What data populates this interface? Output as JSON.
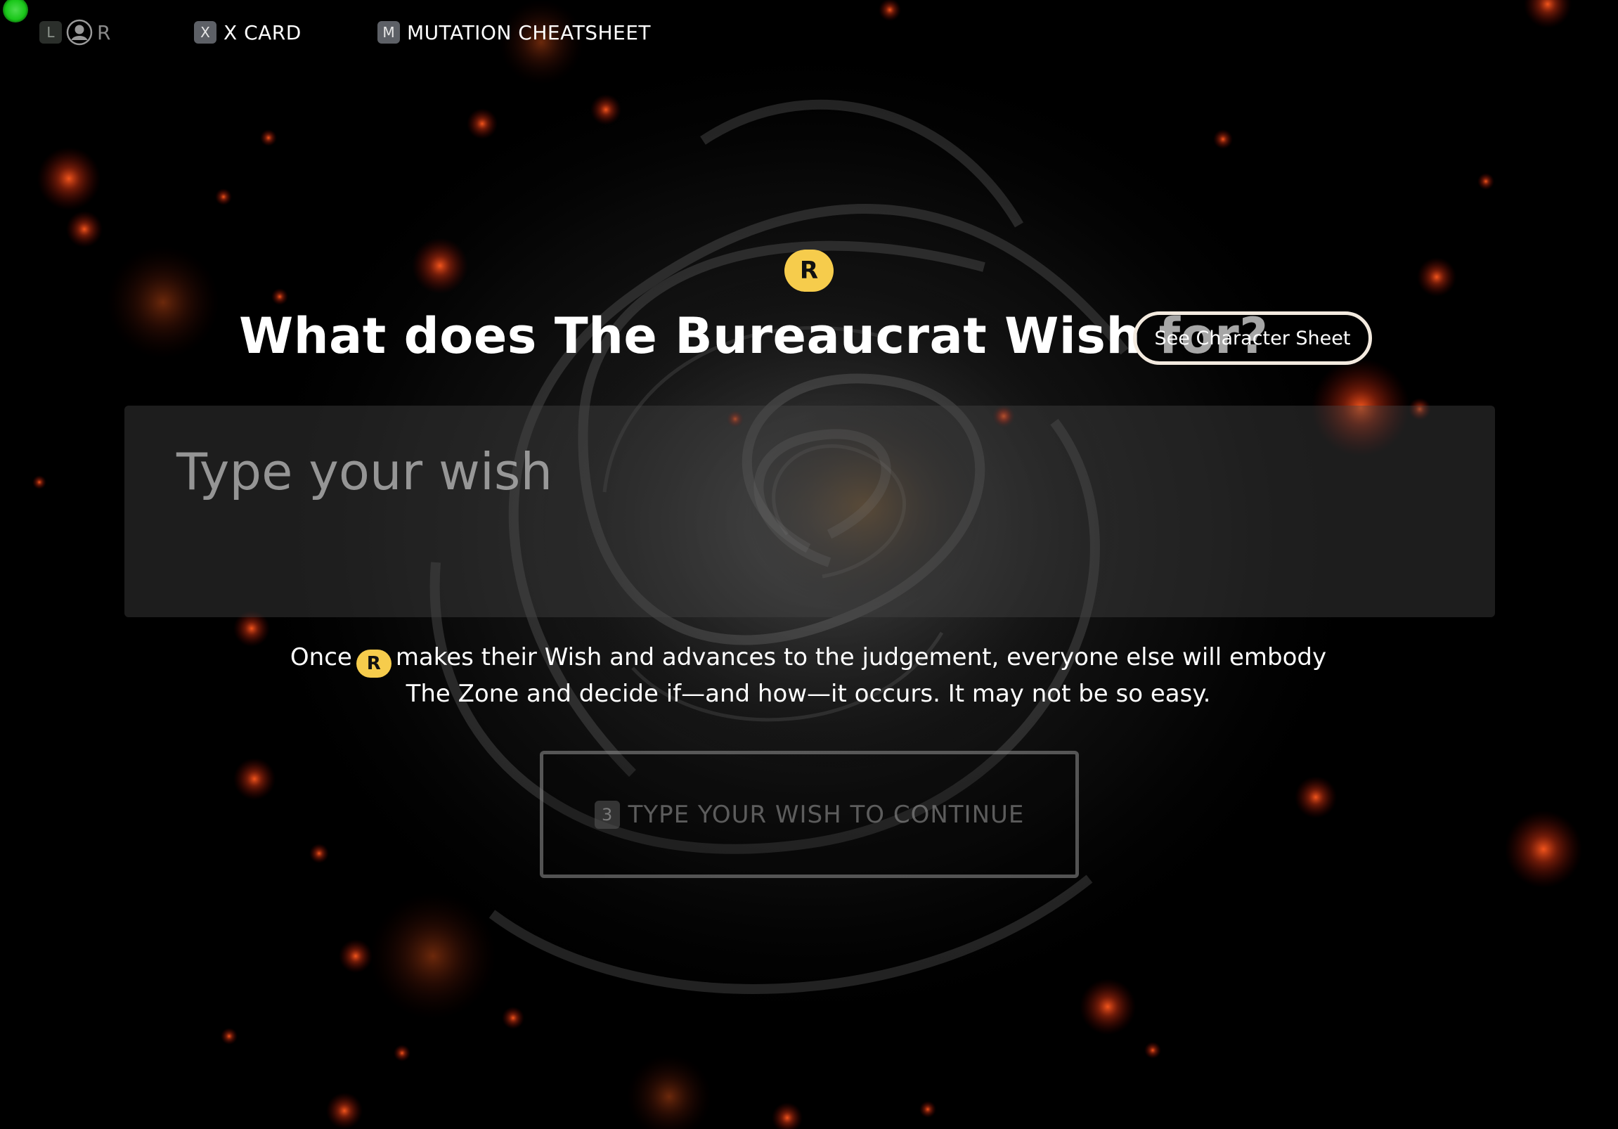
{
  "toolbar": {
    "roles": {
      "key": "L",
      "label": "R",
      "icon": "user-circle-icon"
    },
    "xcard": {
      "key": "X",
      "label": "X CARD"
    },
    "cheatsheet": {
      "key": "M",
      "label": "MUTATION CHEATSHEET"
    }
  },
  "main": {
    "role_badge": "R",
    "title": "What does The Bureaucrat Wish for?",
    "character_sheet_button": "See Character Sheet",
    "wish_input": {
      "value": "",
      "placeholder": "Type your wish"
    },
    "info": {
      "before": "Once",
      "badge": "R",
      "after": "makes their Wish and advances to the judgement, everyone else will embody",
      "line2": "The Zone and decide if—and how—it occurs. It may not be so easy."
    },
    "continue_button": {
      "key": "3",
      "label": "TYPE YOUR WISH TO CONTINUE",
      "enabled": false
    }
  },
  "colors": {
    "background": "#000000",
    "accent_badge": "#f6cc4c",
    "ember": "#e0401a",
    "status_indicator": "#19c719"
  }
}
